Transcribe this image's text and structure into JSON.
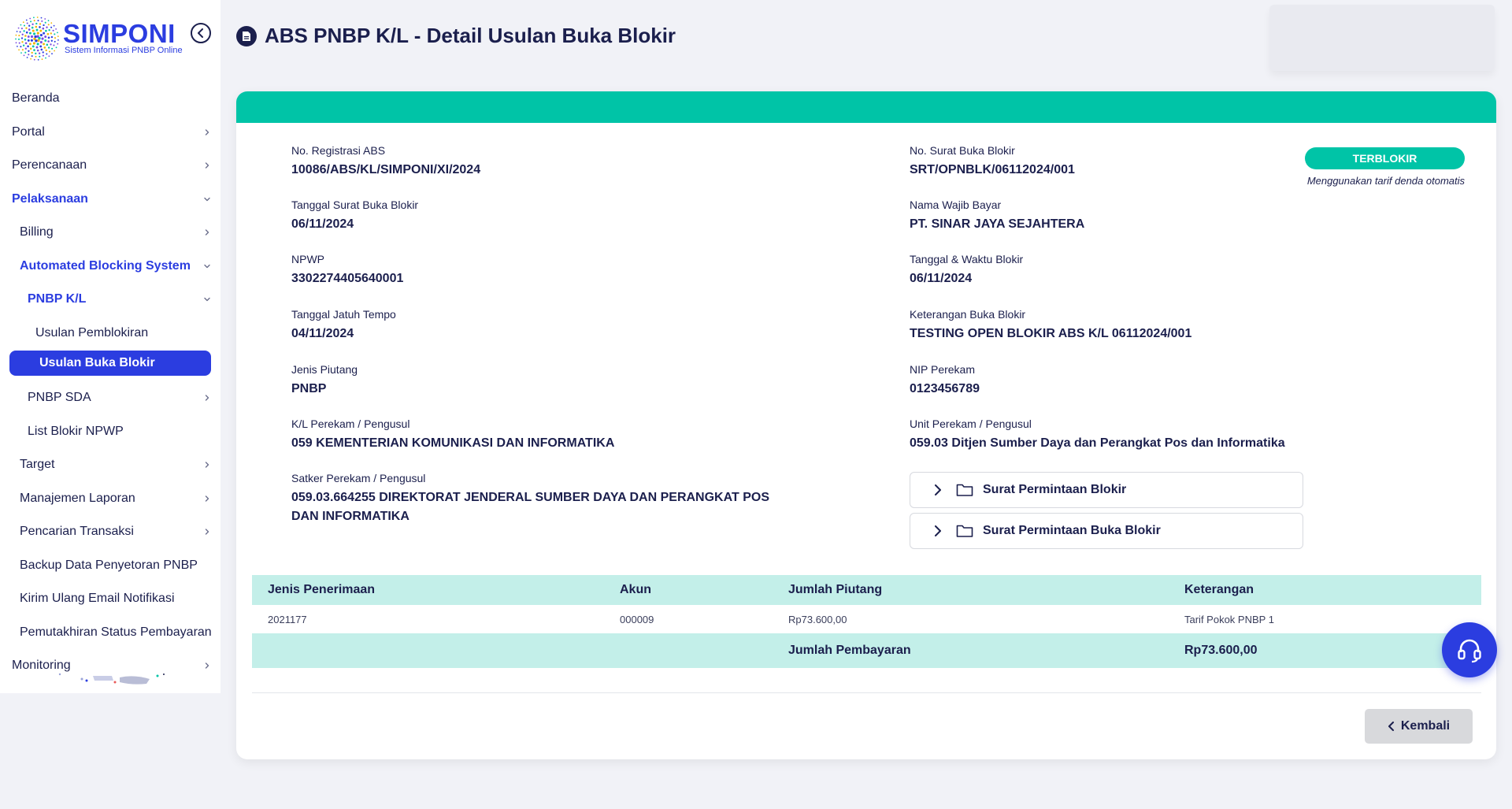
{
  "brand": {
    "name": "SIMPONI",
    "subtitle": "Sistem Informasi PNBP Online",
    "color": "#2b3de0"
  },
  "sidebar": {
    "items": [
      {
        "label": "Beranda",
        "level": 0,
        "chevron": false
      },
      {
        "label": "Portal",
        "level": 0,
        "chevron": "right"
      },
      {
        "label": "Perencanaan",
        "level": 0,
        "chevron": "right"
      },
      {
        "label": "Pelaksanaan",
        "level": 0,
        "chevron": "down",
        "active": true
      },
      {
        "label": "Billing",
        "level": 1,
        "chevron": "right"
      },
      {
        "label": "Automated Blocking System",
        "level": 1,
        "chevron": "down",
        "active": true
      },
      {
        "label": "PNBP K/L",
        "level": 2,
        "chevron": "down",
        "active": true
      },
      {
        "label": "Usulan Pemblokiran",
        "level": 3,
        "chevron": false
      },
      {
        "label": "Usulan Buka Blokir",
        "level": 3,
        "chevron": false,
        "selected": true
      },
      {
        "label": "PNBP SDA",
        "level": 2,
        "chevron": "right"
      },
      {
        "label": "List Blokir NPWP",
        "level": 2,
        "chevron": false
      },
      {
        "label": "Target",
        "level": 1,
        "chevron": "right"
      },
      {
        "label": "Manajemen Laporan",
        "level": 1,
        "chevron": "right"
      },
      {
        "label": "Pencarian Transaksi",
        "level": 1,
        "chevron": "right"
      },
      {
        "label": "Backup Data Penyetoran PNBP",
        "level": 1,
        "chevron": false
      },
      {
        "label": "Kirim Ulang Email Notifikasi",
        "level": 1,
        "chevron": false
      },
      {
        "label": "Pemutakhiran Status Pembayaran",
        "level": 1,
        "chevron": false
      },
      {
        "label": "Monitoring",
        "level": 0,
        "chevron": "right"
      }
    ]
  },
  "header": {
    "title": "ABS PNBP K/L - Detail Usulan Buka Blokir"
  },
  "detail": {
    "left": [
      {
        "label": "No. Registrasi ABS",
        "value": "10086/ABS/KL/SIMPONI/XI/2024"
      },
      {
        "label": "Tanggal Surat Buka Blokir",
        "value": "06/11/2024"
      },
      {
        "label": "NPWP",
        "value": "3302274405640001"
      },
      {
        "label": "Tanggal Jatuh Tempo",
        "value": "04/11/2024"
      },
      {
        "label": "Jenis Piutang",
        "value": "PNBP"
      },
      {
        "label": "K/L Perekam / Pengusul",
        "value": "059 KEMENTERIAN KOMUNIKASI DAN INFORMATIKA"
      },
      {
        "label": "Satker Perekam / Pengusul",
        "value": "059.03.664255 DIREKTORAT JENDERAL SUMBER DAYA DAN PERANGKAT POS DAN INFORMATIKA"
      }
    ],
    "right": [
      {
        "label": "No. Surat Buka Blokir",
        "value": "SRT/OPNBLK/06112024/001"
      },
      {
        "label": "Nama Wajib Bayar",
        "value": "PT. SINAR JAYA SEJAHTERA"
      },
      {
        "label": "Tanggal & Waktu Blokir",
        "value": "06/11/2024"
      },
      {
        "label": "Keterangan Buka Blokir",
        "value": "TESTING OPEN BLOKIR ABS K/L 06112024/001"
      },
      {
        "label": "NIP Perekam",
        "value": "0123456789"
      },
      {
        "label": "Unit Perekam / Pengusul",
        "value": "059.03 Ditjen Sumber Daya dan Perangkat Pos dan Informatika"
      }
    ],
    "status": "TERBLOKIR",
    "status_color": "#00c4a7",
    "status_note": "Menggunakan tarif denda otomatis",
    "folders": [
      "Surat Permintaan Blokir",
      "Surat Permintaan Buka Blokir"
    ]
  },
  "table": {
    "headers": [
      "Jenis Penerimaan",
      "Akun",
      "Jumlah Piutang",
      "Keterangan"
    ],
    "rows": [
      [
        "2021177",
        "000009",
        "Rp73.600,00",
        "Tarif Pokok PNBP 1"
      ]
    ],
    "footer": {
      "label": "Jumlah Pembayaran",
      "value": "Rp73.600,00"
    }
  },
  "actions": {
    "back_label": "Kembali"
  }
}
